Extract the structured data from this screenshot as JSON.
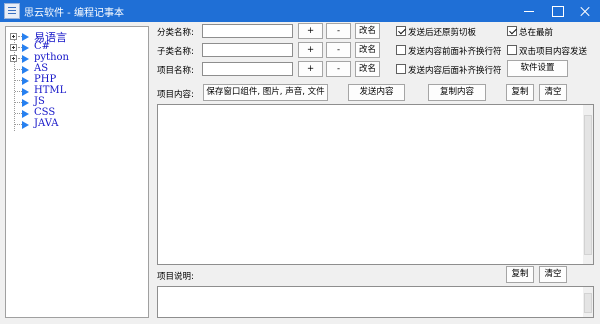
{
  "window": {
    "title": "思云软件 - 编程记事本"
  },
  "tree": {
    "items": [
      {
        "label": "易语言",
        "expandable": true
      },
      {
        "label": "C#",
        "expandable": true
      },
      {
        "label": "python",
        "expandable": true
      },
      {
        "label": "AS",
        "expandable": false
      },
      {
        "label": "PHP",
        "expandable": false
      },
      {
        "label": "HTML",
        "expandable": false
      },
      {
        "label": "JS",
        "expandable": false
      },
      {
        "label": "CSS",
        "expandable": false
      },
      {
        "label": "JAVA",
        "expandable": false
      }
    ]
  },
  "form": {
    "category_label": "分类名称:",
    "subcategory_label": "子类名称:",
    "item_label": "项目名称:",
    "category_value": "",
    "subcategory_value": "",
    "item_value": "",
    "add_label": "+",
    "remove_label": "-",
    "rename_label": "改名"
  },
  "options": {
    "restore_clipboard": {
      "label": "发送后还原剪切板",
      "checked": true
    },
    "newline_before": {
      "label": "发送内容前面补齐换行符",
      "checked": false
    },
    "newline_after": {
      "label": "发送内容后面补齐换行符",
      "checked": false
    },
    "always_on_top": {
      "label": "总在最前",
      "checked": true
    },
    "double_click_send": {
      "label": "双击项目内容发送",
      "checked": false
    },
    "settings_label": "软件设置"
  },
  "content": {
    "label": "项目内容:",
    "save_label": "保存窗口组件, 图片, 声音, 文件",
    "send_label": "发送内容",
    "copy_content_label": "复制内容",
    "copy_label": "复制",
    "clear_label": "清空",
    "text": ""
  },
  "description": {
    "label": "项目说明:",
    "copy_label": "复制",
    "clear_label": "清空",
    "text": ""
  },
  "colors": {
    "titlebar": "#1f6fd6",
    "tree_text": "#1515c8",
    "tree_arrow": "#2680f0"
  }
}
